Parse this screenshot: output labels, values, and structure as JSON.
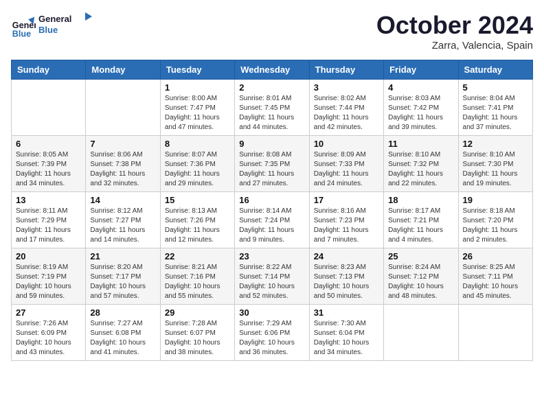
{
  "logo": {
    "line1": "General",
    "line2": "Blue"
  },
  "title": "October 2024",
  "location": "Zarra, Valencia, Spain",
  "weekdays": [
    "Sunday",
    "Monday",
    "Tuesday",
    "Wednesday",
    "Thursday",
    "Friday",
    "Saturday"
  ],
  "weeks": [
    [
      {
        "day": null,
        "info": ""
      },
      {
        "day": null,
        "info": ""
      },
      {
        "day": "1",
        "info": "Sunrise: 8:00 AM\nSunset: 7:47 PM\nDaylight: 11 hours and 47 minutes."
      },
      {
        "day": "2",
        "info": "Sunrise: 8:01 AM\nSunset: 7:45 PM\nDaylight: 11 hours and 44 minutes."
      },
      {
        "day": "3",
        "info": "Sunrise: 8:02 AM\nSunset: 7:44 PM\nDaylight: 11 hours and 42 minutes."
      },
      {
        "day": "4",
        "info": "Sunrise: 8:03 AM\nSunset: 7:42 PM\nDaylight: 11 hours and 39 minutes."
      },
      {
        "day": "5",
        "info": "Sunrise: 8:04 AM\nSunset: 7:41 PM\nDaylight: 11 hours and 37 minutes."
      }
    ],
    [
      {
        "day": "6",
        "info": "Sunrise: 8:05 AM\nSunset: 7:39 PM\nDaylight: 11 hours and 34 minutes."
      },
      {
        "day": "7",
        "info": "Sunrise: 8:06 AM\nSunset: 7:38 PM\nDaylight: 11 hours and 32 minutes."
      },
      {
        "day": "8",
        "info": "Sunrise: 8:07 AM\nSunset: 7:36 PM\nDaylight: 11 hours and 29 minutes."
      },
      {
        "day": "9",
        "info": "Sunrise: 8:08 AM\nSunset: 7:35 PM\nDaylight: 11 hours and 27 minutes."
      },
      {
        "day": "10",
        "info": "Sunrise: 8:09 AM\nSunset: 7:33 PM\nDaylight: 11 hours and 24 minutes."
      },
      {
        "day": "11",
        "info": "Sunrise: 8:10 AM\nSunset: 7:32 PM\nDaylight: 11 hours and 22 minutes."
      },
      {
        "day": "12",
        "info": "Sunrise: 8:10 AM\nSunset: 7:30 PM\nDaylight: 11 hours and 19 minutes."
      }
    ],
    [
      {
        "day": "13",
        "info": "Sunrise: 8:11 AM\nSunset: 7:29 PM\nDaylight: 11 hours and 17 minutes."
      },
      {
        "day": "14",
        "info": "Sunrise: 8:12 AM\nSunset: 7:27 PM\nDaylight: 11 hours and 14 minutes."
      },
      {
        "day": "15",
        "info": "Sunrise: 8:13 AM\nSunset: 7:26 PM\nDaylight: 11 hours and 12 minutes."
      },
      {
        "day": "16",
        "info": "Sunrise: 8:14 AM\nSunset: 7:24 PM\nDaylight: 11 hours and 9 minutes."
      },
      {
        "day": "17",
        "info": "Sunrise: 8:16 AM\nSunset: 7:23 PM\nDaylight: 11 hours and 7 minutes."
      },
      {
        "day": "18",
        "info": "Sunrise: 8:17 AM\nSunset: 7:21 PM\nDaylight: 11 hours and 4 minutes."
      },
      {
        "day": "19",
        "info": "Sunrise: 8:18 AM\nSunset: 7:20 PM\nDaylight: 11 hours and 2 minutes."
      }
    ],
    [
      {
        "day": "20",
        "info": "Sunrise: 8:19 AM\nSunset: 7:19 PM\nDaylight: 10 hours and 59 minutes."
      },
      {
        "day": "21",
        "info": "Sunrise: 8:20 AM\nSunset: 7:17 PM\nDaylight: 10 hours and 57 minutes."
      },
      {
        "day": "22",
        "info": "Sunrise: 8:21 AM\nSunset: 7:16 PM\nDaylight: 10 hours and 55 minutes."
      },
      {
        "day": "23",
        "info": "Sunrise: 8:22 AM\nSunset: 7:14 PM\nDaylight: 10 hours and 52 minutes."
      },
      {
        "day": "24",
        "info": "Sunrise: 8:23 AM\nSunset: 7:13 PM\nDaylight: 10 hours and 50 minutes."
      },
      {
        "day": "25",
        "info": "Sunrise: 8:24 AM\nSunset: 7:12 PM\nDaylight: 10 hours and 48 minutes."
      },
      {
        "day": "26",
        "info": "Sunrise: 8:25 AM\nSunset: 7:11 PM\nDaylight: 10 hours and 45 minutes."
      }
    ],
    [
      {
        "day": "27",
        "info": "Sunrise: 7:26 AM\nSunset: 6:09 PM\nDaylight: 10 hours and 43 minutes."
      },
      {
        "day": "28",
        "info": "Sunrise: 7:27 AM\nSunset: 6:08 PM\nDaylight: 10 hours and 41 minutes."
      },
      {
        "day": "29",
        "info": "Sunrise: 7:28 AM\nSunset: 6:07 PM\nDaylight: 10 hours and 38 minutes."
      },
      {
        "day": "30",
        "info": "Sunrise: 7:29 AM\nSunset: 6:06 PM\nDaylight: 10 hours and 36 minutes."
      },
      {
        "day": "31",
        "info": "Sunrise: 7:30 AM\nSunset: 6:04 PM\nDaylight: 10 hours and 34 minutes."
      },
      {
        "day": null,
        "info": ""
      },
      {
        "day": null,
        "info": ""
      }
    ]
  ]
}
